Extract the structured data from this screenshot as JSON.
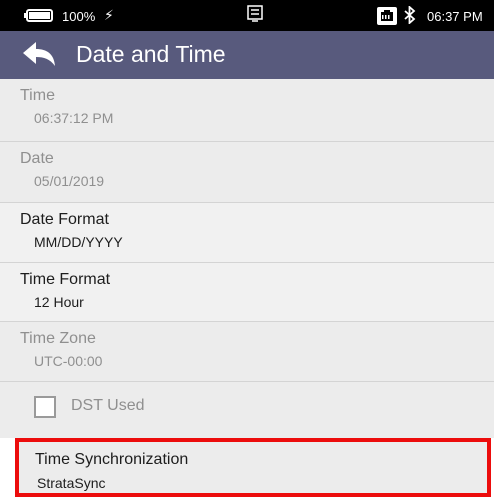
{
  "status_bar": {
    "battery_text": "100%",
    "charging_symbol": "⚡",
    "time": "06:37 PM"
  },
  "header": {
    "title": "Date and Time"
  },
  "settings": {
    "time": {
      "label": "Time",
      "value": "06:37:12 PM"
    },
    "date": {
      "label": "Date",
      "value": "05/01/2019"
    },
    "date_format": {
      "label": "Date Format",
      "value": "MM/DD/YYYY"
    },
    "time_format": {
      "label": "Time Format",
      "value": "12 Hour"
    },
    "time_zone": {
      "label": "Time Zone",
      "value": "UTC-00:00"
    },
    "dst_used": {
      "label": "DST Used",
      "checked": false
    },
    "time_synchronization": {
      "label": "Time Synchronization",
      "value": "StrataSync"
    }
  },
  "colors": {
    "header_background": "#585a7d",
    "highlight_border": "#ec0c0c",
    "disabled_text": "#8f8f8f",
    "enabled_text": "#1d1d1d"
  },
  "icons": {
    "battery": "battery-icon",
    "charging": "lightning-bolt-icon",
    "dock": "dock-icon",
    "ethernet": "ethernet-icon",
    "bluetooth": "bluetooth-icon",
    "back": "back-arrow-icon",
    "checkbox": "checkbox-icon"
  }
}
